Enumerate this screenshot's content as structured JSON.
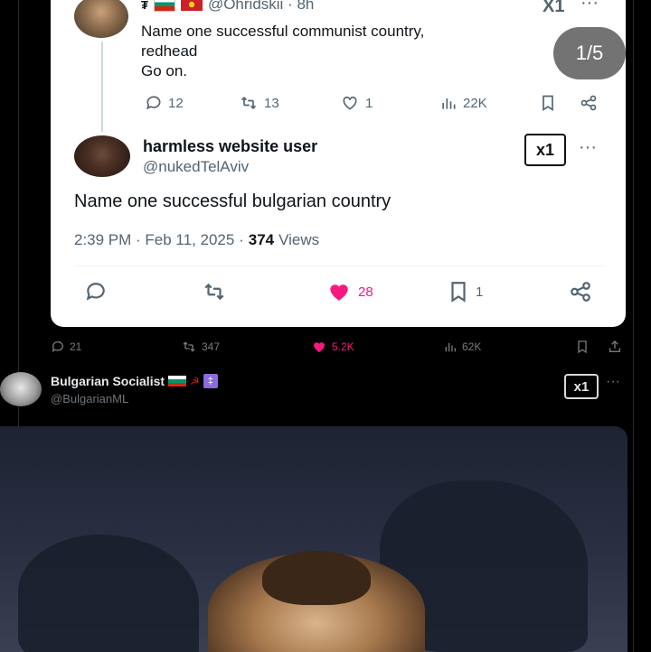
{
  "pager": {
    "label": "1/5"
  },
  "quoted_parent": {
    "handle_line": "@Ohridskii · 8h",
    "text_line1": "Name one successful communist country,",
    "text_line2": "redhead",
    "text_line3": "Go on.",
    "replies": "12",
    "retweets": "13",
    "likes": "1",
    "views": "22K"
  },
  "reply_tweet": {
    "name": "harmless website user",
    "handle": "@nukedTelAviv",
    "text": "Name one successful bulgarian country",
    "time": "2:39 PM · Feb 11, 2025 ·",
    "views_count": "374",
    "views_label": "Views",
    "likes": "28",
    "bookmarks": "1",
    "grok_label": "x1",
    "more_label": "···"
  },
  "outer_tweet": {
    "stats": {
      "replies": "21",
      "retweets": "347",
      "likes": "5.2K",
      "views": "62K"
    },
    "next_author": {
      "name": "Bulgarian Socialist",
      "handle": "@BulgarianML",
      "grok_label": "x1",
      "more_label": "···"
    }
  },
  "colors": {
    "like_pink": "#f91880",
    "muted_gray": "#536471",
    "card_bg": "#ffffff",
    "page_bg": "#000000",
    "flag_white": "#ffffff",
    "flag_green": "#00966e",
    "flag_red": "#d62612",
    "mk_red": "#ce2028",
    "mk_yellow": "#f9d616"
  }
}
